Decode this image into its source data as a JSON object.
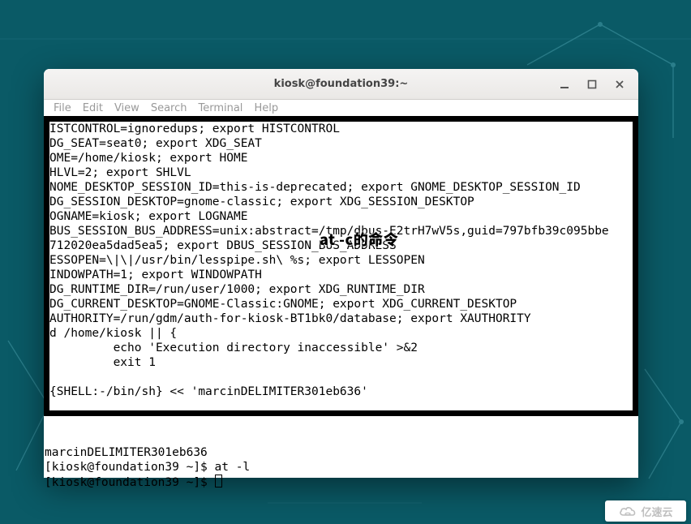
{
  "window": {
    "title": "kiosk@foundation39:~",
    "controls": {
      "minimize": "minimize",
      "maximize": "maximize",
      "close": "close"
    }
  },
  "menubar": [
    "File",
    "Edit",
    "View",
    "Search",
    "Terminal",
    "Help"
  ],
  "terminal_framed_lines": [
    "ISTCONTROL=ignoredups; export HISTCONTROL",
    "DG_SEAT=seat0; export XDG_SEAT",
    "OME=/home/kiosk; export HOME",
    "HLVL=2; export SHLVL",
    "NOME_DESKTOP_SESSION_ID=this-is-deprecated; export GNOME_DESKTOP_SESSION_ID",
    "DG_SESSION_DESKTOP=gnome-classic; export XDG_SESSION_DESKTOP",
    "OGNAME=kiosk; export LOGNAME",
    "BUS_SESSION_BUS_ADDRESS=unix:abstract=/tmp/dbus-E2trH7wV5s,guid=797bfb39c095bbe",
    "712020ea5dad5ea5; export DBUS_SESSION_BUS_ADDRESS",
    "ESSOPEN=\\|\\|/usr/bin/lesspipe.sh\\ %s; export LESSOPEN",
    "INDOWPATH=1; export WINDOWPATH",
    "DG_RUNTIME_DIR=/run/user/1000; export XDG_RUNTIME_DIR",
    "DG_CURRENT_DESKTOP=GNOME-Classic:GNOME; export XDG_CURRENT_DESKTOP",
    "AUTHORITY=/run/gdm/auth-for-kiosk-BT1bk0/database; export XAUTHORITY",
    "d /home/kiosk || {",
    "         echo 'Execution directory inaccessible' >&2",
    "         exit 1",
    "",
    "{SHELL:-/bin/sh} << 'marcinDELIMITER301eb636'",
    ""
  ],
  "terminal_below_lines": [
    "",
    "marcinDELIMITER301eb636",
    "[kiosk@foundation39 ~]$ at -l",
    "[kiosk@foundation39 ~]$ "
  ],
  "overlay": "at -c的命令",
  "watermark": "亿速云"
}
